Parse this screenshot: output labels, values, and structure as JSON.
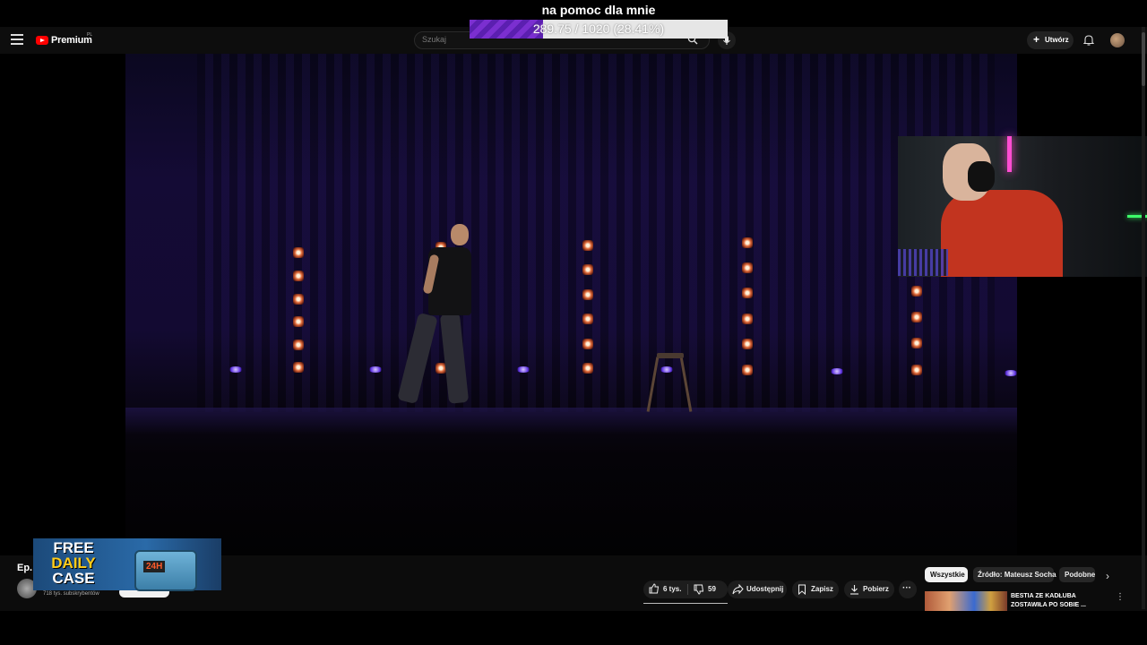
{
  "header": {
    "logo_text": "Premium",
    "region": "PL",
    "search_placeholder": "Szukaj",
    "create_label": "Utwórz"
  },
  "overlay": {
    "title": "na pomoc dla mnie",
    "progress_text": "289.75 / 1020 (28.41%)",
    "progress_fraction": 0.2841
  },
  "channel": {
    "episode_label": "Ep.",
    "subscribers": "718 tys. subskrybentów"
  },
  "promo": {
    "line1": "FREE",
    "line2": "DAILY",
    "line3": "CASE",
    "badge": "24H"
  },
  "actions": {
    "likes": "6 tys.",
    "dislikes": "59",
    "share": "Udostępnij",
    "save": "Zapisz",
    "download": "Pobierz"
  },
  "chips": [
    "Wszystkie",
    "Źródło: Mateusz Socha",
    "Podobne"
  ],
  "recommended": {
    "title": "BESTIA ZE KADŁUBA ZOSTAWIŁA PO SOBIE ..."
  },
  "colors": {
    "brand_red": "#ff0000",
    "progress_purple": "#7b2fd0",
    "stage_blue": "#140b35"
  }
}
